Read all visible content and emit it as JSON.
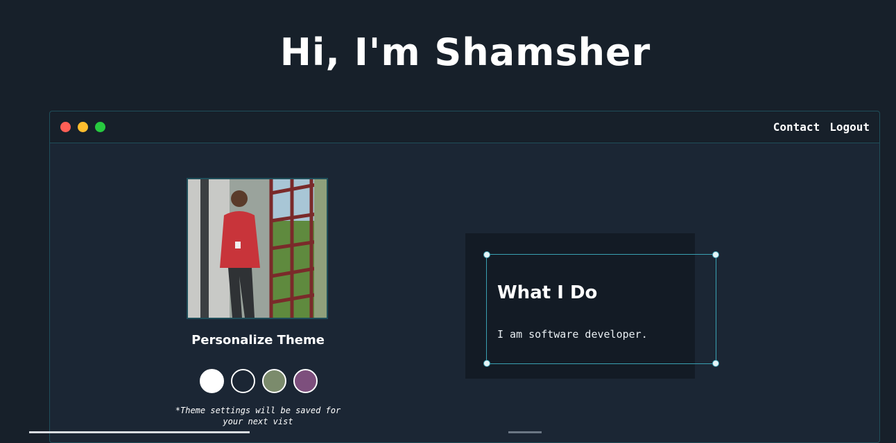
{
  "header": {
    "title": "Hi, I'm Shamsher"
  },
  "window": {
    "nav": {
      "contact_label": "Contact",
      "logout_label": "Logout"
    }
  },
  "theme": {
    "heading": "Personalize Theme",
    "swatches": [
      {
        "name": "white",
        "color": "#ffffff"
      },
      {
        "name": "dark",
        "color": "#1b2634"
      },
      {
        "name": "sage",
        "color": "#7b8b6c"
      },
      {
        "name": "plum",
        "color": "#7d4f7d"
      }
    ],
    "note": "*Theme settings will be saved for your next vist"
  },
  "about": {
    "heading": "What I Do",
    "text": "I am software developer."
  }
}
